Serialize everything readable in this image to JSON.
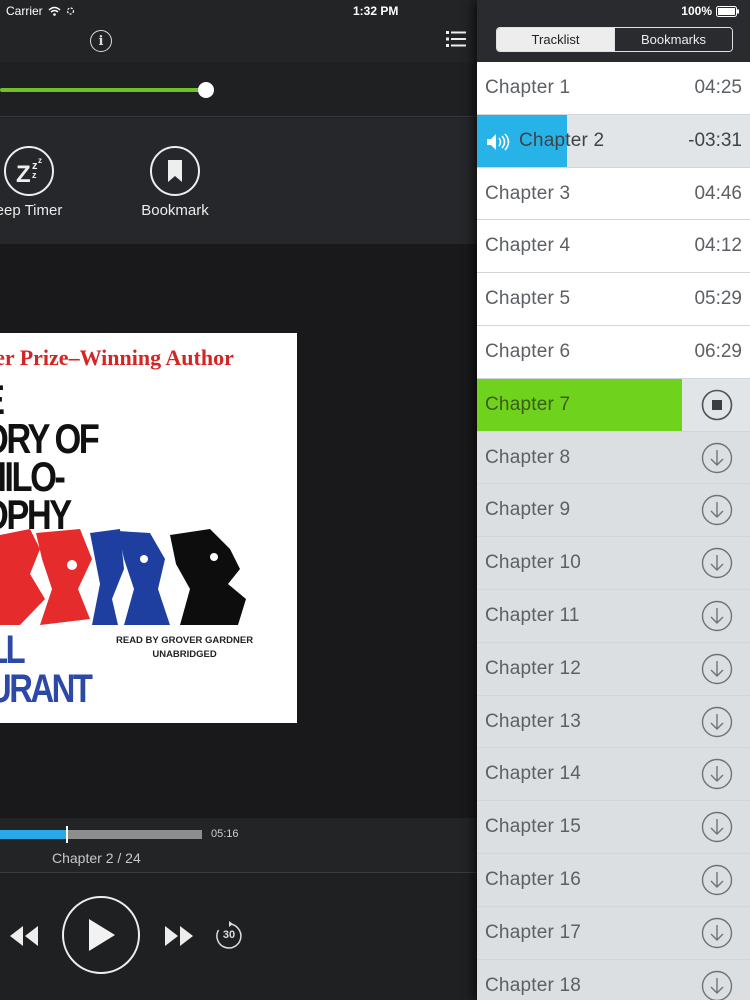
{
  "status_bar": {
    "carrier": "Carrier",
    "time": "1:32 PM",
    "battery": "100%"
  },
  "player": {
    "volume_level": 0.92,
    "actions": {
      "sleep_label": "eep Timer",
      "bookmark_label": "Bookmark"
    },
    "cover": {
      "tagline": "tzer Prize–Winning Author",
      "title_lines": [
        "E",
        "ORY OF",
        "HILO-",
        "OPHY"
      ],
      "reader_line1": "READ BY GROVER GARDNER",
      "reader_line2": "UNABRIDGED",
      "author_lines": [
        "LL",
        "URANT"
      ]
    },
    "progress": {
      "fraction": 0.33,
      "remaining": "05:16",
      "chapter_count": "Chapter 2 / 24"
    },
    "skip_seconds": "30"
  },
  "tabs": {
    "tracklist": "Tracklist",
    "bookmarks": "Bookmarks"
  },
  "tracks": [
    {
      "title": "Chapter 1",
      "duration": "04:25",
      "state": "plain"
    },
    {
      "title": "Chapter 2",
      "duration": "-03:31",
      "state": "playing"
    },
    {
      "title": "Chapter 3",
      "duration": "04:46",
      "state": "plain"
    },
    {
      "title": "Chapter 4",
      "duration": "04:12",
      "state": "plain"
    },
    {
      "title": "Chapter 5",
      "duration": "05:29",
      "state": "plain"
    },
    {
      "title": "Chapter 6",
      "duration": "06:29",
      "state": "plain"
    },
    {
      "title": "Chapter 7",
      "duration": "",
      "state": "downloading"
    },
    {
      "title": "Chapter 8",
      "duration": "",
      "state": "remote"
    },
    {
      "title": "Chapter 9",
      "duration": "",
      "state": "remote"
    },
    {
      "title": "Chapter 10",
      "duration": "",
      "state": "remote"
    },
    {
      "title": "Chapter 11",
      "duration": "",
      "state": "remote"
    },
    {
      "title": "Chapter 12",
      "duration": "",
      "state": "remote"
    },
    {
      "title": "Chapter 13",
      "duration": "",
      "state": "remote"
    },
    {
      "title": "Chapter 14",
      "duration": "",
      "state": "remote"
    },
    {
      "title": "Chapter 15",
      "duration": "",
      "state": "remote"
    },
    {
      "title": "Chapter 16",
      "duration": "",
      "state": "remote"
    },
    {
      "title": "Chapter 17",
      "duration": "",
      "state": "remote"
    },
    {
      "title": "Chapter 18",
      "duration": "",
      "state": "remote"
    }
  ],
  "colors": {
    "accent_green": "#6fd21c",
    "accent_blue": "#27b3e8",
    "panel_bg": "#ffffff",
    "player_bg": "#1e1f21"
  },
  "icons": {
    "speaker": "speaker-icon",
    "download": "download-icon",
    "stop": "stop-download-icon"
  }
}
